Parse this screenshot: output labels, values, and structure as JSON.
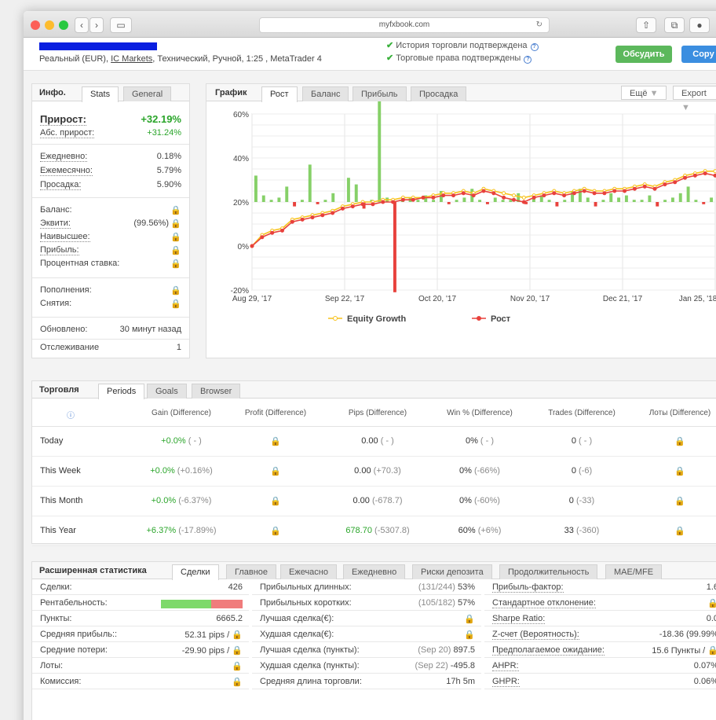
{
  "browser": {
    "url": "myfxbook.com"
  },
  "account": {
    "desc_prefix": "Реальный (EUR), ",
    "broker": "IC Markets",
    "desc_suffix": ", Технический, Ручной, 1:25 , MetaTrader 4",
    "verified_history": "История торговли подтверждена",
    "verified_rights": "Торговые права подтверждены",
    "discuss_btn": "Обсудить",
    "copy_btn": "Copy"
  },
  "info": {
    "title": "Инфо.",
    "tabs": [
      "Stats",
      "General"
    ],
    "growth_label": "Прирост:",
    "growth_value": "+32.19%",
    "abs_label": "Абс. прирост:",
    "abs_value": "+31.24%",
    "daily_label": "Ежедневно:",
    "daily_value": "0.18%",
    "monthly_label": "Ежемесячно:",
    "monthly_value": "5.79%",
    "dd_label": "Просадка:",
    "dd_value": "5.90%",
    "balance_label": "Баланс:",
    "equity_label": "Эквити:",
    "equity_pct": "(99.56%)",
    "highest_label": "Наивысшее:",
    "profit_label": "Прибыль:",
    "interest_label": "Процентная ставка:",
    "deposits_label": "Пополнения:",
    "withdrawals_label": "Снятия:",
    "updated_label": "Обновлено:",
    "updated_value": "30 минут назад",
    "tracking_label": "Отслеживание",
    "tracking_value": "1"
  },
  "chart_panel": {
    "title": "График",
    "tabs": [
      "Рост",
      "Баланс",
      "Прибыль",
      "Просадка"
    ],
    "more": "Ещё",
    "export": "Export"
  },
  "chart_data": {
    "type": "line",
    "y_ticks": [
      "60%",
      "40%",
      "20%",
      "0%",
      "-20%"
    ],
    "x_ticks": [
      "Aug 29, '17",
      "Sep 22, '17",
      "Oct 20, '17",
      "Nov 20, '17",
      "Dec 21, '17",
      "Jan 25, '18"
    ],
    "ylim": [
      -20,
      60
    ],
    "series": [
      {
        "name": "Equity Growth",
        "color": "#f7c21b",
        "values": [
          0,
          5,
          7,
          8,
          12,
          13,
          14,
          15,
          16,
          18,
          19,
          20,
          20,
          21,
          21,
          22,
          22,
          22,
          23,
          24,
          24,
          25,
          24,
          26,
          25,
          24,
          23,
          22,
          23,
          24,
          25,
          24,
          25,
          26,
          25,
          25,
          26,
          26,
          27,
          28,
          27,
          29,
          30,
          32,
          33,
          34,
          34
        ]
      },
      {
        "name": "Рост",
        "color": "#e8413c",
        "values": [
          0,
          4,
          6,
          7,
          11,
          12,
          13,
          14,
          15,
          17,
          18,
          19,
          19,
          20,
          20,
          21,
          21,
          22,
          22,
          23,
          23,
          24,
          23,
          25,
          24,
          22,
          21,
          20,
          22,
          23,
          24,
          23,
          24,
          25,
          24,
          24,
          25,
          25,
          26,
          27,
          26,
          28,
          29,
          31,
          32,
          33,
          32
        ]
      }
    ],
    "daily_bars": [
      12,
      3,
      1,
      2,
      7,
      -2,
      1,
      17,
      -1,
      1,
      4,
      0,
      11,
      8,
      -3,
      1,
      46,
      2,
      -41,
      1,
      2,
      1,
      3,
      1,
      5,
      -1,
      1,
      2,
      6,
      1,
      -1,
      2,
      1,
      1,
      4,
      -1,
      2,
      3,
      1,
      -2,
      1,
      5,
      6,
      2,
      -2,
      1,
      4,
      2,
      3,
      1,
      1,
      3,
      -2,
      1,
      2,
      4,
      7,
      1,
      -1,
      2
    ]
  },
  "trading": {
    "title": "Торговля",
    "tabs": [
      "Periods",
      "Goals",
      "Browser"
    ],
    "headers": [
      "Gain (Difference)",
      "Profit (Difference)",
      "Pips (Difference)",
      "Win % (Difference)",
      "Trades (Difference)",
      "Лоты (Difference)"
    ],
    "rows": [
      {
        "period": "Today",
        "gain": "+0.0%",
        "gain_diff": "( - )",
        "pips": "0.00",
        "pips_diff": "( - )",
        "win": "0%",
        "win_diff": "( - )",
        "trades": "0",
        "trades_diff": "( - )"
      },
      {
        "period": "This Week",
        "gain": "+0.0%",
        "gain_diff": "(+0.16%)",
        "pips": "0.00",
        "pips_diff": "(+70.3)",
        "win": "0%",
        "win_diff": "(-66%)",
        "trades": "0",
        "trades_diff": "(-6)"
      },
      {
        "period": "This Month",
        "gain": "+0.0%",
        "gain_diff": "(-6.37%)",
        "pips": "0.00",
        "pips_diff": "(-678.7)",
        "win": "0%",
        "win_diff": "(-60%)",
        "trades": "0",
        "trades_diff": "(-33)"
      },
      {
        "period": "This Year",
        "gain": "+6.37%",
        "gain_diff": "(-17.89%)",
        "pips": "678.70",
        "pips_diff": "(-5307.8)",
        "win": "60%",
        "win_diff": "(+6%)",
        "trades": "33",
        "trades_diff": "(-360)"
      }
    ]
  },
  "advanced": {
    "title": "Расширенная статистика",
    "tabs": [
      "Сделки",
      "Главное",
      "Ежечасно",
      "Ежедневно",
      "Риски депозита",
      "Продолжительность",
      "MAE/MFE"
    ],
    "col1": [
      {
        "label": "Сделки:",
        "value": "426"
      },
      {
        "label": "Рентабельность:",
        "value": ""
      },
      {
        "label": "Пункты:",
        "value": "6665.2"
      },
      {
        "label": "Средняя прибыль::",
        "value": "52.31 pips /"
      },
      {
        "label": "Средние потери:",
        "value": "-29.90 pips /"
      },
      {
        "label": "Лоты:",
        "value": ""
      },
      {
        "label": "Комиссия:",
        "value": ""
      }
    ],
    "col2": [
      {
        "label": "Прибыльных длинных:",
        "grey": "(131/244)",
        "value": "53%"
      },
      {
        "label": "Прибыльных коротких:",
        "grey": "(105/182)",
        "value": "57%"
      },
      {
        "label": "Лучшая сделка(€):",
        "grey": "",
        "value": ""
      },
      {
        "label": "Худшая сделка(€):",
        "grey": "",
        "value": ""
      },
      {
        "label": "Лучшая сделка (пункты):",
        "grey": "(Sep 20)",
        "value": "897.5"
      },
      {
        "label": "Худшая сделка (пункты):",
        "grey": "(Sep 22)",
        "value": "-495.8"
      },
      {
        "label": "Средняя длина торговли:",
        "grey": "",
        "value": "17h 5m"
      }
    ],
    "col3": [
      {
        "label": "Прибыль-фактор:",
        "value": "1.6"
      },
      {
        "label": "Стандартное отклонение:",
        "value": ""
      },
      {
        "label": "Sharpe Ratio:",
        "value": "0.0"
      },
      {
        "label": "Z-счет (Вероятность):",
        "value": "-18.36 (99.99%"
      },
      {
        "label": "Предполагаемое ожидание:",
        "value": "15.6 Пункты /"
      },
      {
        "label": "AHPR:",
        "value": "0.07%"
      },
      {
        "label": "GHPR:",
        "value": "0.06%"
      }
    ],
    "profitability_win_pct": 62
  }
}
